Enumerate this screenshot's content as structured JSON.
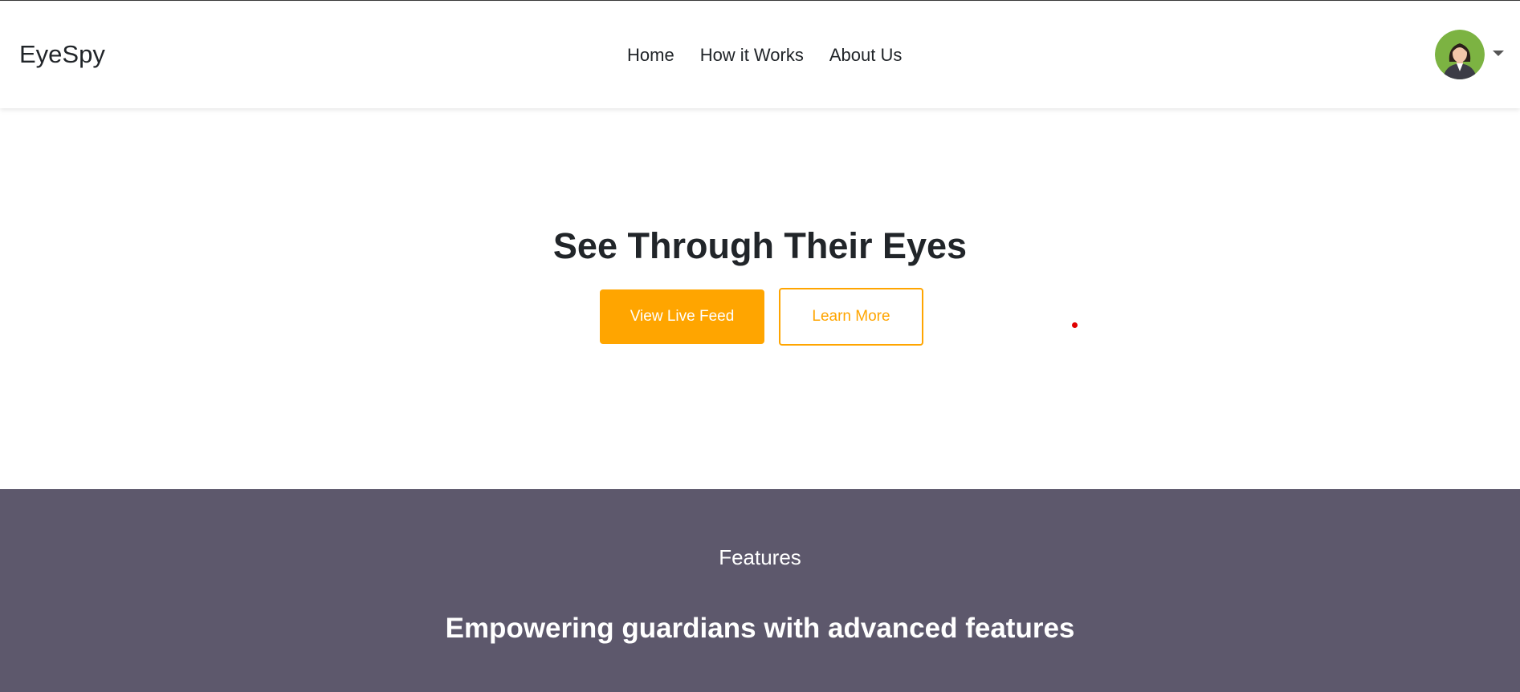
{
  "navbar": {
    "brand": "EyeSpy",
    "links": [
      {
        "label": "Home"
      },
      {
        "label": "How it Works"
      },
      {
        "label": "About Us"
      }
    ],
    "profile": {
      "avatar_icon": "user-avatar-icon",
      "dropdown_icon": "caret-down-icon"
    }
  },
  "hero": {
    "title": "See Through Their Eyes",
    "primary_button": "View Live Feed",
    "secondary_button": "Learn More"
  },
  "features": {
    "label": "Features",
    "heading": "Empowering guardians with advanced features"
  },
  "colors": {
    "accent": "#ffa500",
    "features_bg": "#5d586c",
    "text": "#212529"
  }
}
